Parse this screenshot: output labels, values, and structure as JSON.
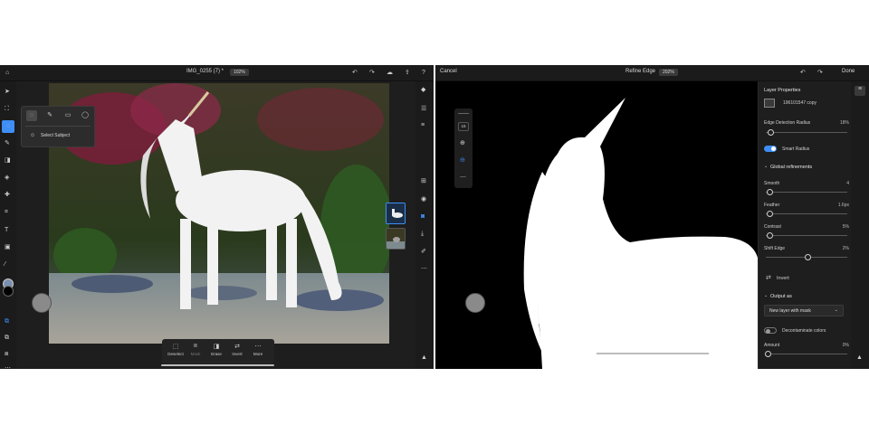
{
  "left": {
    "header": {
      "title": "IMG_0255 (7) *",
      "zoom": "102%"
    },
    "popover": {
      "select_subject_label": "Select Subject"
    },
    "bottom_bar": {
      "deselect": "Deselect",
      "mask": "Mask",
      "erase": "Erase",
      "invert": "Invert",
      "more": "More"
    },
    "icons": {
      "home": "home-icon",
      "undo": "undo-icon",
      "redo": "redo-icon",
      "cloud": "cloud-icon",
      "share": "share-icon",
      "help": "help-icon"
    }
  },
  "right": {
    "header": {
      "cancel_label": "Cancel",
      "title": "Refine Edge",
      "zoom": "202%",
      "done_label": "Done"
    },
    "tool_box": {
      "brush_size": "16"
    },
    "panel": {
      "layer_properties_title": "Layer Properties",
      "layer_name": "196101547 copy",
      "edge_detection_label": "Edge Detection Radius",
      "edge_detection_value": "18%",
      "edge_detection_level": 0.18,
      "smart_radius_label": "Smart Radius",
      "smart_radius_on": true,
      "global_refinements_title": "Global refinements",
      "smooth_label": "Smooth",
      "smooth_value": "4",
      "feather_label": "Feather",
      "feather_value": "1.6px",
      "contrast_label": "Contrast",
      "contrast_value": "5%",
      "shift_edge_label": "Shift Edge",
      "shift_edge_value": "2%",
      "invert_label": "Invert",
      "output_as_title": "Output as",
      "output_option": "New layer with mask",
      "decontaminate_label": "Decontaminate colors",
      "decontaminate_on": false,
      "amount_label": "Amount",
      "amount_value": "0%"
    }
  },
  "colors": {
    "accent": "#3e8ef7",
    "ui_dark": "#1e1e1e"
  }
}
